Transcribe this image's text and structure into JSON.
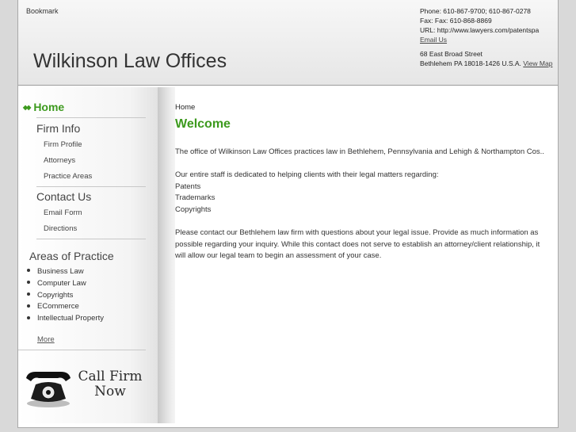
{
  "header": {
    "bookmark": "Bookmark",
    "site_title": "Wilkinson Law Offices",
    "contact": {
      "phone": "Phone: 610-867-9700; 610-867-0278",
      "fax": "Fax: Fax: 610-868-8869",
      "url": "URL: http://www.lawyers.com/patentspa",
      "email_link": "Email Us",
      "street": "68 East Broad Street",
      "city": "Bethlehem PA 18018-1426 U.S.A.",
      "map_link": "View Map"
    }
  },
  "sidebar": {
    "home": "Home",
    "firm_info": "Firm Info",
    "firm_profile": "Firm Profile",
    "attorneys": "Attorneys",
    "practice_areas": "Practice Areas",
    "contact_us": "Contact Us",
    "email_form": "Email Form",
    "directions": "Directions",
    "areas_title": "Areas of Practice",
    "areas": [
      "Business Law",
      "Computer Law",
      "Copyrights",
      "ECommerce",
      "Intellectual Property"
    ],
    "more": "More",
    "call_firm_line1": "Call Firm",
    "call_firm_line2": "Now"
  },
  "main": {
    "breadcrumb": "Home",
    "title": "Welcome",
    "intro": "The office of Wilkinson Law Offices practices law in Bethlehem, Pennsylvania and Lehigh & Northampton Cos..",
    "staff": "Our entire staff is dedicated to helping clients with their legal matters regarding:",
    "matters": [
      "Patents",
      "Trademarks",
      "Copyrights"
    ],
    "closing": "Please contact our Bethlehem law firm with questions about your legal issue. Provide as much information as possible regarding your inquiry. While this contact does not serve to establish an attorney/client relationship, it will allow our legal team to begin an assessment of your case."
  },
  "colors": {
    "accent_green": "#3d9a1e",
    "text": "#333333",
    "background": "#d9d9d9"
  }
}
